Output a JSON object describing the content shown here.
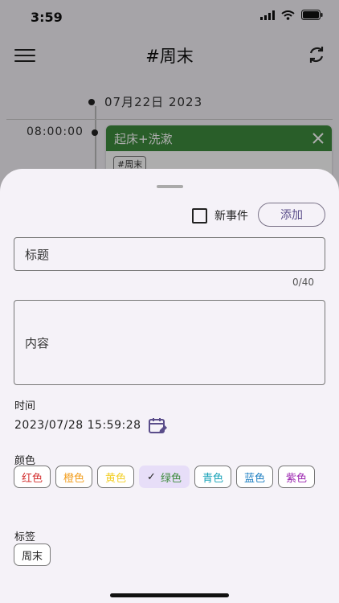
{
  "status_bar": {
    "time": "3:59"
  },
  "app_bar": {
    "title": "#周末"
  },
  "timeline": {
    "date": "07月22日 2023",
    "time": "08:00:00",
    "event_title": "起床+洗漱",
    "event_tag": "#周末",
    "event_color": "#3d8b3d"
  },
  "sheet": {
    "new_event_label": "新事件",
    "add_button": "添加",
    "title_placeholder": "标题",
    "title_counter": "0/40",
    "content_placeholder": "内容",
    "time_label": "时间",
    "datetime_value": "2023/07/28 15:59:28",
    "color_label": "颜色",
    "colors": [
      {
        "name": "红色",
        "hex": "#d32f2f",
        "selected": false
      },
      {
        "name": "橙色",
        "hex": "#f29d1c",
        "selected": false
      },
      {
        "name": "黄色",
        "hex": "#f3d02a",
        "selected": false
      },
      {
        "name": "绿色",
        "hex": "#3d8b3d",
        "selected": true
      },
      {
        "name": "青色",
        "hex": "#17a2b8",
        "selected": false
      },
      {
        "name": "蓝色",
        "hex": "#1e7fc2",
        "selected": false
      },
      {
        "name": "紫色",
        "hex": "#9c27b0",
        "selected": false
      }
    ],
    "tag_label": "标签",
    "tag_value": "周末"
  }
}
